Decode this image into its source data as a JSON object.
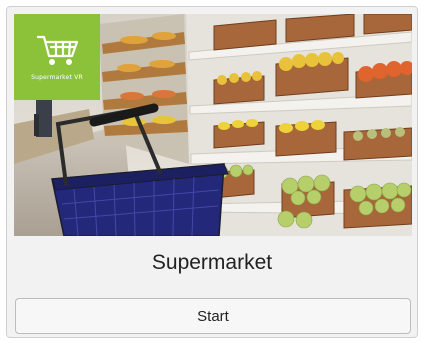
{
  "card": {
    "title": "Supermarket",
    "start_label": "Start",
    "badge": {
      "label": "Supermarket VR",
      "icon": "shopping-cart-icon",
      "color": "#8bc23a"
    }
  }
}
